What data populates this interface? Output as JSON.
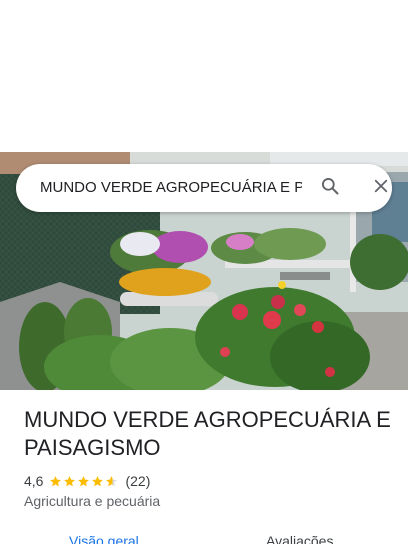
{
  "search": {
    "query": "MUNDO VERDE AGROPECUÁRIA E P"
  },
  "place": {
    "title": "MUNDO VERDE AGROPECUÁRIA E PAISAGISMO",
    "rating": "4,6",
    "rating_value": 4.6,
    "review_count": "(22)",
    "category": "Agricultura e pecuária"
  },
  "tabs": [
    {
      "label": "Visão geral",
      "active": true
    },
    {
      "label": "Avaliações",
      "active": false
    }
  ],
  "icons": {
    "search": "search-icon",
    "close": "close-icon",
    "star": "star-icon"
  },
  "colors": {
    "accent": "#1a73e8",
    "star": "#fbbc04",
    "star_empty": "#dadce0",
    "text_primary": "#202124",
    "text_secondary": "#5f6368"
  }
}
